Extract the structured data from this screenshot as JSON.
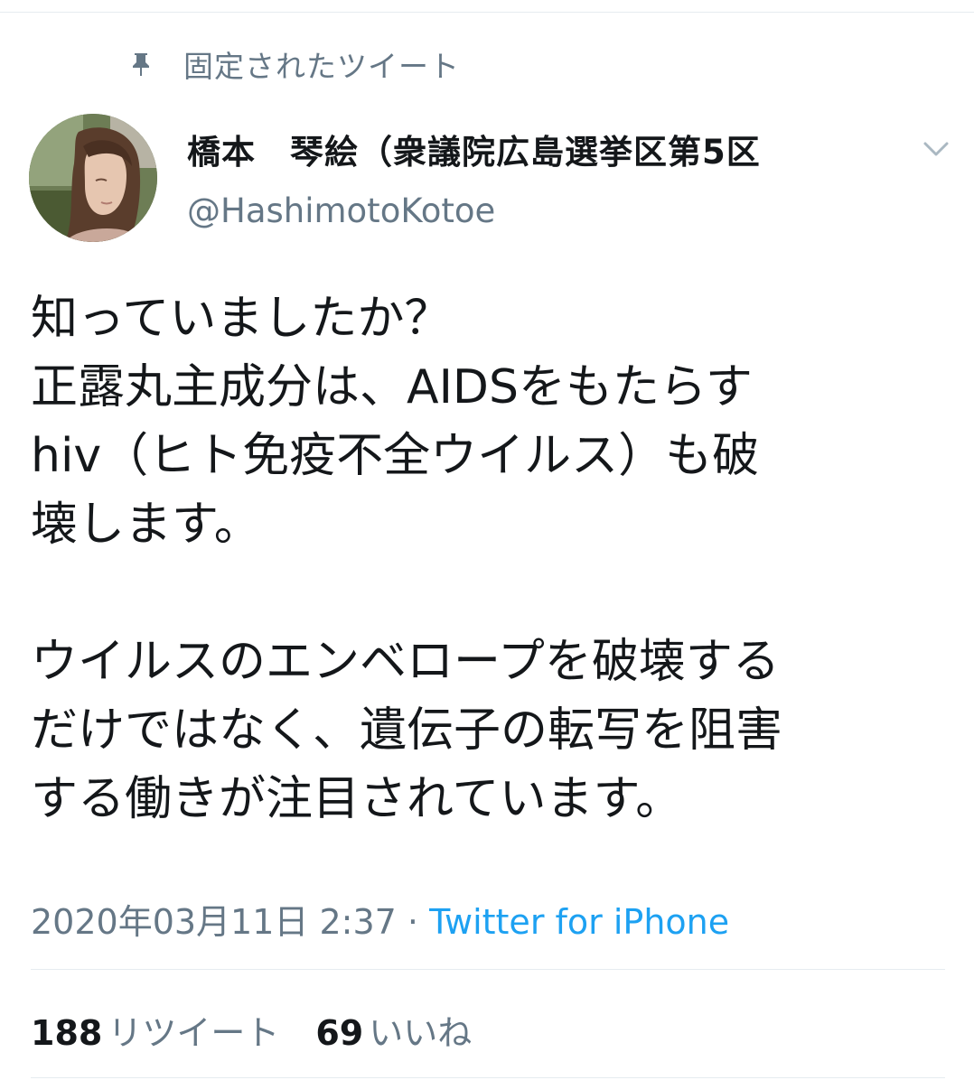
{
  "pinned": {
    "icon": "pin-icon",
    "label": "固定されたツイート"
  },
  "author": {
    "display_name": "橋本　琴絵（衆議院広島選挙区第5区",
    "handle": "@HashimotoKotoe",
    "avatar": "avatar"
  },
  "menu": {
    "icon": "chevron-down-icon"
  },
  "tweet": {
    "text": "知っていましたか？\n正露丸主成分は、AIDSをもたらす\nhiv（ヒト免疫不全ウイルス）も破\n壊します。\n\nウイルスのエンベロープを破壊する\nだけではなく、遺伝子の転写を阻害\nする働きが注目されています。"
  },
  "meta": {
    "timestamp": "2020年03月11日 2:37",
    "separator": " · ",
    "source": "Twitter for iPhone"
  },
  "stats": {
    "retweets_count": "188",
    "retweets_label": "リツイート",
    "likes_count": "69",
    "likes_label": "いいね"
  },
  "colors": {
    "secondary_text": "#657786",
    "link": "#1da1f2",
    "divider": "#e6ecf0"
  }
}
